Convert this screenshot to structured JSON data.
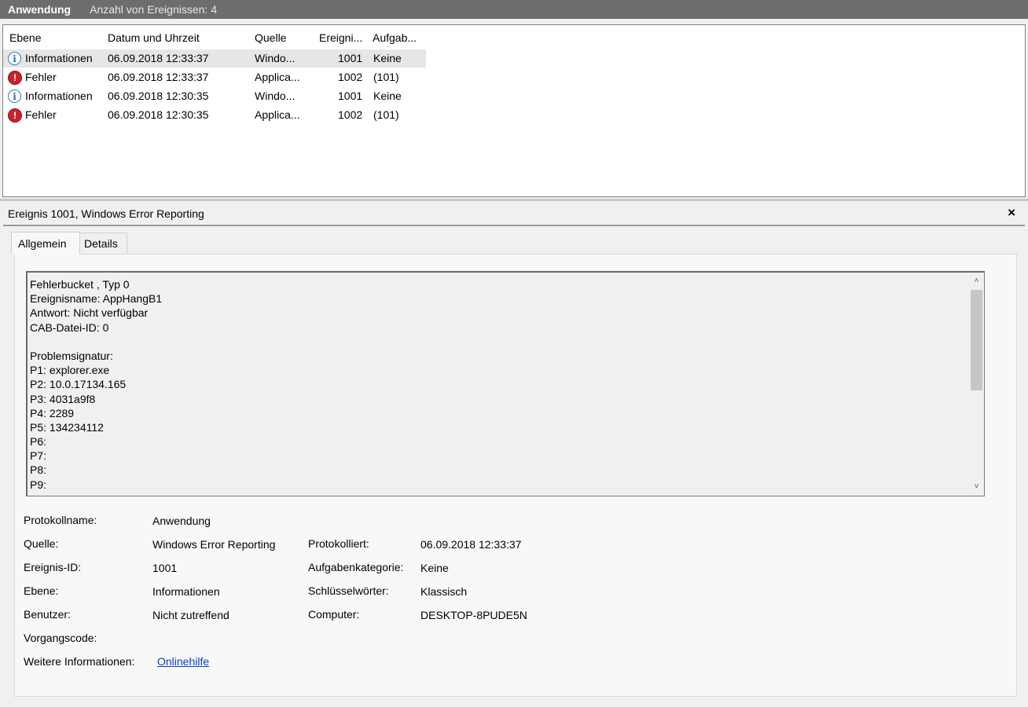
{
  "header": {
    "title": "Anwendung",
    "count_label": "Anzahl von Ereignissen: 4"
  },
  "list": {
    "columns": [
      "Ebene",
      "Datum und Uhrzeit",
      "Quelle",
      "Ereigni...",
      "Aufgab..."
    ],
    "rows": [
      {
        "icon": "info-icon",
        "level": "Informationen",
        "date": "06.09.2018 12:33:37",
        "source": "Windo...",
        "id": "1001",
        "task": "Keine"
      },
      {
        "icon": "error-icon",
        "level": "Fehler",
        "date": "06.09.2018 12:33:37",
        "source": "Applica...",
        "id": "1002",
        "task": "(101)"
      },
      {
        "icon": "info-icon",
        "level": "Informationen",
        "date": "06.09.2018 12:30:35",
        "source": "Windo...",
        "id": "1001",
        "task": "Keine"
      },
      {
        "icon": "error-icon",
        "level": "Fehler",
        "date": "06.09.2018 12:30:35",
        "source": "Applica...",
        "id": "1002",
        "task": "(101)"
      }
    ]
  },
  "detail": {
    "title": "Ereignis 1001, Windows Error Reporting",
    "close_label": "×",
    "tabs": [
      "Allgemein",
      "Details"
    ],
    "description_lines": [
      "Fehlerbucket , Typ 0",
      "Ereignisname: AppHangB1",
      "Antwort: Nicht verfügbar",
      "CAB-Datei-ID: 0",
      "",
      "Problemsignatur:",
      "P1: explorer.exe",
      "P2: 10.0.17134.165",
      "P3: 4031a9f8",
      "P4: 2289",
      "P5: 134234112",
      "P6:",
      "P7:",
      "P8:",
      "P9:"
    ],
    "scroll_up": "˄",
    "scroll_down": "˅",
    "props": {
      "log_name_label": "Protokollname:",
      "log_name": "Anwendung",
      "source_label": "Quelle:",
      "source": "Windows Error Reporting",
      "logged_label": "Protokolliert:",
      "logged": "06.09.2018 12:33:37",
      "event_id_label": "Ereignis-ID:",
      "event_id": "1001",
      "task_label": "Aufgabenkategorie:",
      "task": "Keine",
      "level_label": "Ebene:",
      "level": "Informationen",
      "keywords_label": "Schlüsselwörter:",
      "keywords": "Klassisch",
      "user_label": "Benutzer:",
      "user": "Nicht zutreffend",
      "computer_label": "Computer:",
      "computer": "DESKTOP-8PUDE5N",
      "opcode_label": "Vorgangscode:",
      "more_info_label": "Weitere Informationen:",
      "more_info_link": "Onlinehilfe"
    }
  }
}
